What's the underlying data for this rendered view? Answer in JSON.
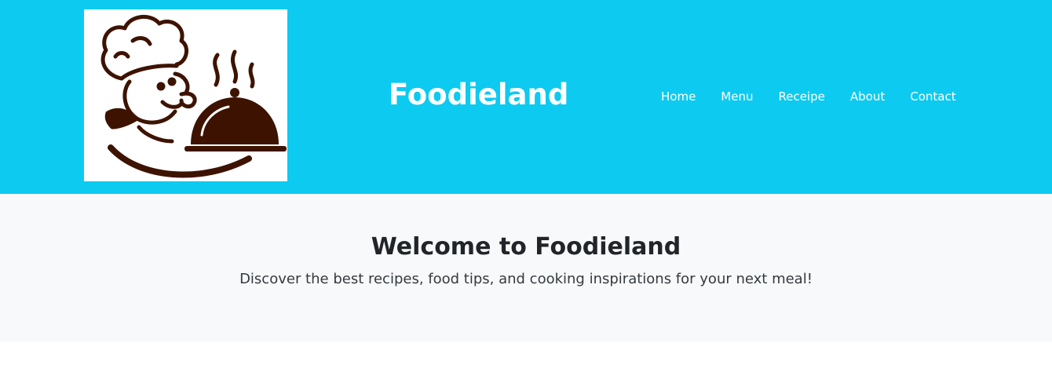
{
  "header": {
    "logo_icon": "chef-with-cloche-logo",
    "brand": "Foodieland",
    "background_color": "#0dcaf0"
  },
  "nav": {
    "items": [
      {
        "label": "Home"
      },
      {
        "label": "Menu"
      },
      {
        "label": "Receipe"
      },
      {
        "label": "About"
      },
      {
        "label": "Contact"
      }
    ]
  },
  "hero": {
    "title": "Welcome to Foodieland",
    "subtitle": "Discover the best recipes, food tips, and cooking inspirations for your next meal!",
    "background_color": "#f8f9fa"
  }
}
